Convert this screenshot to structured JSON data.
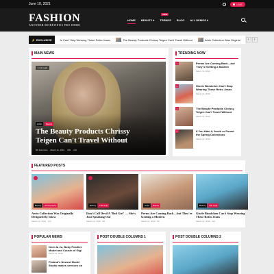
{
  "topbar": {
    "date": "June 10, 2021",
    "live_label": "LIVE"
  },
  "header": {
    "logo": "FASHION",
    "tagline": "ANOTHER MOREWEWS PRO DEMO",
    "nav": [
      {
        "label": "HOME"
      },
      {
        "label": "BEAUTY ▾"
      },
      {
        "label": "TRENDS",
        "badge": "NEW"
      },
      {
        "label": "BLOG"
      },
      {
        "label": "ALL DEMOS ▾"
      }
    ]
  },
  "ticker": {
    "label": "EXCLUSIVE",
    "items": [
      "ts Can't Stop Wearing These Retro Jeans",
      "The Beauty Products Chrissy Teigen Can't Travel Without",
      "Aerie Collection Was Original"
    ]
  },
  "main_news": {
    "heading": "MAIN NEWS",
    "stamp": "1 min read",
    "tags": [
      "Artist",
      "Beauty"
    ],
    "title": "The Beauty Products Chrissy Teigen Can't Travel Without",
    "author": "NF Dummies",
    "date": "March 11, 2019",
    "views": "199",
    "comments": "110"
  },
  "trending": {
    "heading": "TRENDING NOW",
    "items": [
      {
        "num": "1",
        "title": "Perms Are Coming Back—but They're Getting a Modern",
        "date": "March 11, 2019"
      },
      {
        "num": "2",
        "title": "Gisele Bündchen Can't Stop Wearing These Retro Jeans",
        "date": "March 11, 2019"
      },
      {
        "num": "3",
        "title": "The Beauty Products Chrissy Teigen Can't Travel Without",
        "date": "March 11, 2019"
      },
      {
        "num": "4",
        "title": "If You Hate It, Avoid or Found the Spring Collections",
        "date": "March 11, 2019"
      }
    ]
  },
  "featured": {
    "heading": "FEATURED POSTS",
    "items": [
      {
        "tags": [
          "Beauty",
          "Photography"
        ],
        "title": "Aerie Collection Was Originally Designed By Iskra",
        "date": "March 12, 2019",
        "views": "174"
      },
      {
        "tags": [
          "Beauty",
          "Life style"
        ],
        "title": "Don't Call Devil A 'Bad Girl' — She's Just Speaking Out",
        "date": "March 12, 2019",
        "views": "88"
      },
      {
        "tags": [
          "Artist",
          "Beauty"
        ],
        "title": "Perms Are Coming Back—but They're Getting a Modern",
        "date": "March 11, 2019",
        "views": "95"
      },
      {
        "tags": [
          "Beauty",
          "Life style"
        ],
        "title": "Gisele Bündchen Can't Stop Wearing These Retro Jeans",
        "date": "March 11, 2019",
        "views": "121"
      }
    ]
  },
  "popular": {
    "heading": "POPULAR NEWS",
    "items": [
      {
        "title": "Next Ja Ju, Body Positive Model and Cousin of Gigi",
        "date": "March 11, 2019"
      },
      {
        "title": "Finland's Newest Model Studio makes services on",
        "date": ""
      }
    ]
  },
  "pdc1": {
    "heading": "POST DOUBLE COLUMNS 1"
  },
  "pdc2": {
    "heading": "POST DOUBLE COLUMNS 2"
  },
  "colors": {
    "accent": "#e2174a",
    "dark": "#1b1b1b"
  }
}
